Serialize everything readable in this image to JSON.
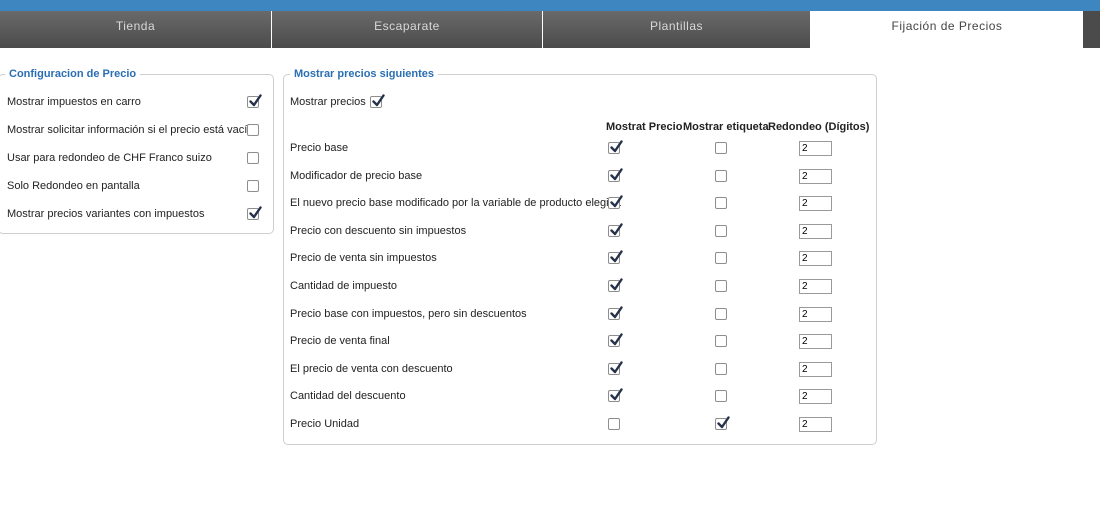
{
  "colors": {
    "topbar": "#3d86c0",
    "tab_dark": "#555555",
    "legend": "#2a6fb3"
  },
  "tabs": [
    {
      "label": "Tienda",
      "active": false
    },
    {
      "label": "Escaparate",
      "active": false
    },
    {
      "label": "Plantillas",
      "active": false
    },
    {
      "label": "Fijación de Precios",
      "active": true
    }
  ],
  "config": {
    "legend": "Configuracion de Precio",
    "items": [
      {
        "label": "Mostrar impuestos en carro",
        "checked": true
      },
      {
        "label": "Mostrar solicitar información si el precio está vacío",
        "checked": false
      },
      {
        "label": "Usar para redondeo de CHF Franco suizo",
        "checked": false
      },
      {
        "label": "Solo Redondeo en pantalla",
        "checked": false
      },
      {
        "label": "Mostrar precios variantes con impuestos",
        "checked": true
      }
    ]
  },
  "show": {
    "legend": "Mostrar precios siguientes",
    "show_prices_label": "Mostrar precios",
    "show_prices_checked": true,
    "columns": [
      "Mostrat Precio",
      "Mostrar etiqueta",
      "Redondeo (Dígitos)"
    ],
    "rows": [
      {
        "label": "Precio base",
        "show": true,
        "tag": false,
        "round": "2"
      },
      {
        "label": "Modificador de precio base",
        "show": true,
        "tag": false,
        "round": "2"
      },
      {
        "label": "El nuevo precio base modificado por la variable de producto elegida",
        "show": true,
        "tag": false,
        "round": "2"
      },
      {
        "label": "Precio con descuento sin impuestos",
        "show": true,
        "tag": false,
        "round": "2"
      },
      {
        "label": "Precio de venta sin impuestos",
        "show": true,
        "tag": false,
        "round": "2"
      },
      {
        "label": "Cantidad de impuesto",
        "show": true,
        "tag": false,
        "round": "2"
      },
      {
        "label": "Precio base con impuestos, pero sin descuentos",
        "show": true,
        "tag": false,
        "round": "2"
      },
      {
        "label": "Precio de venta final",
        "show": true,
        "tag": false,
        "round": "2"
      },
      {
        "label": "El precio de venta con descuento",
        "show": true,
        "tag": false,
        "round": "2"
      },
      {
        "label": "Cantidad del descuento",
        "show": true,
        "tag": false,
        "round": "2"
      },
      {
        "label": "Precio Unidad",
        "show": false,
        "tag": true,
        "round": "2"
      }
    ]
  }
}
